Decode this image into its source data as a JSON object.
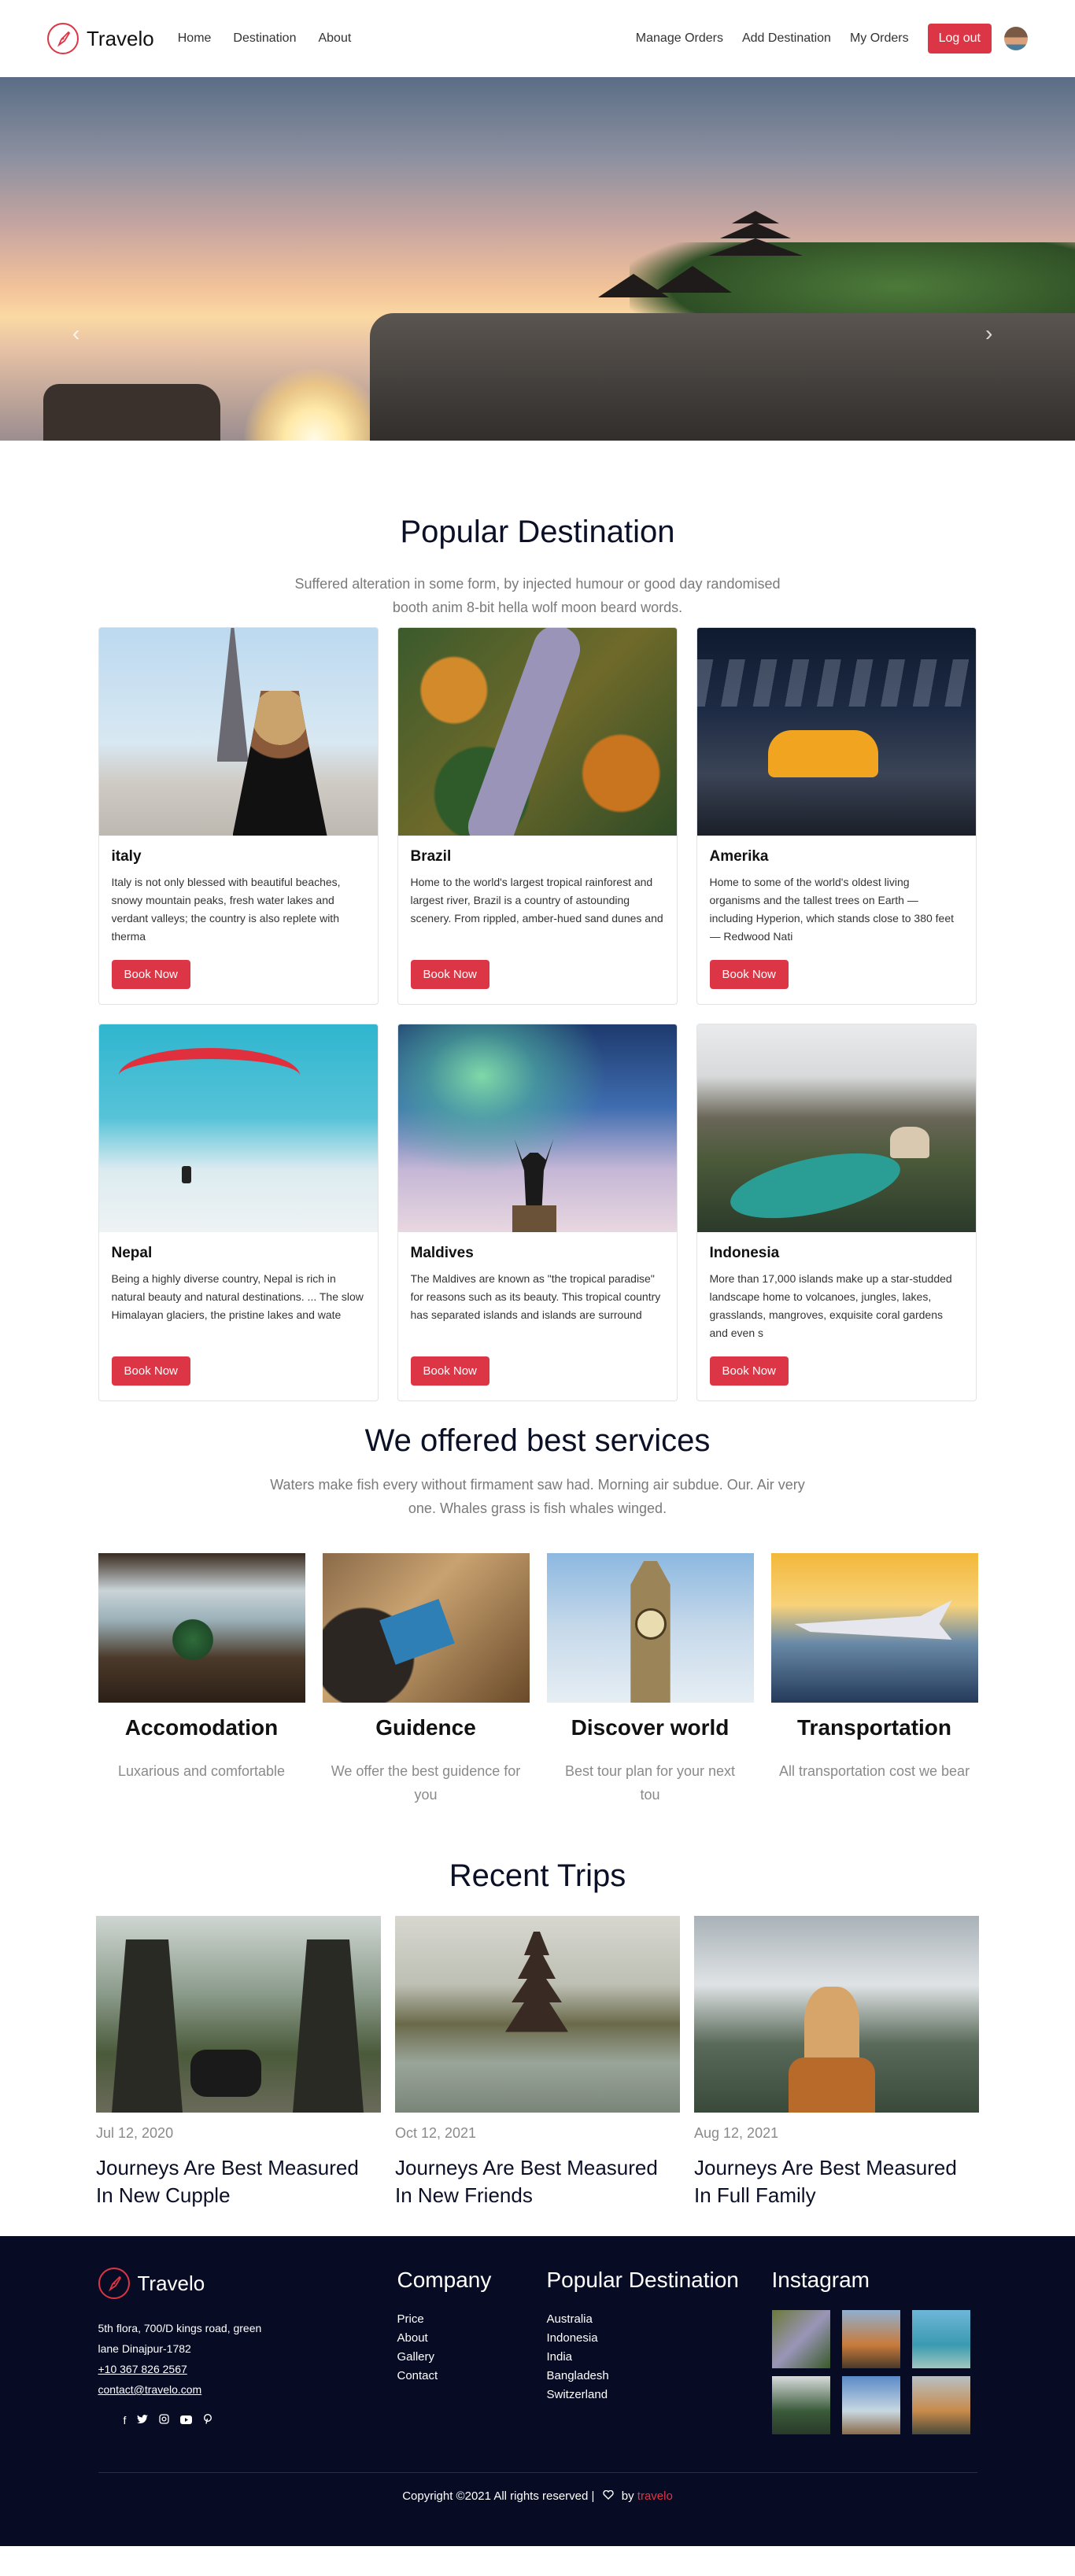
{
  "nav": {
    "brand": "Travelo",
    "links_left": [
      "Home",
      "Destination",
      "About"
    ],
    "links_right": [
      "Manage Orders",
      "Add Destination",
      "My Orders"
    ],
    "logout": "Log out"
  },
  "hero": {
    "prev": "‹",
    "next": "›"
  },
  "popular": {
    "title": "Popular Destination",
    "subtitle": "Suffered alteration in some form, by injected humour or good day randomised booth anim 8-bit hella wolf moon beard words.",
    "book_label": "Book Now",
    "cards": [
      {
        "name": "italy",
        "desc": "Italy is not only blessed with beautiful beaches, snowy mountain peaks, fresh water lakes and verdant valleys; the country is also replete with therma"
      },
      {
        "name": "Brazil",
        "desc": "Home to the world's largest tropical rainforest and largest river, Brazil is a country of astounding scenery. From rippled, amber-hued sand dunes and"
      },
      {
        "name": "Amerika",
        "desc": "Home to some of the world's oldest living organisms and the tallest trees on Earth — including Hyperion, which stands close to 380 feet — Redwood Nati"
      },
      {
        "name": "Nepal",
        "desc": "Being a highly diverse country, Nepal is rich in natural beauty and natural destinations. ... The slow Himalayan glaciers, the pristine lakes and wate"
      },
      {
        "name": "Maldives",
        "desc": "The Maldives are known as \"the tropical paradise\" for reasons such as its beauty. This tropical country has separated islands and islands are surround"
      },
      {
        "name": "Indonesia",
        "desc": "More than 17,000 islands make up a star-studded landscape home to volcanoes, jungles, lakes, grasslands, mangroves, exquisite coral gardens and even s"
      }
    ]
  },
  "services": {
    "title": "We offered best services",
    "subtitle": "Waters make fish every without firmament saw had. Morning air subdue. Our. Air very one. Whales grass is fish whales winged.",
    "items": [
      {
        "title": "Accomodation",
        "desc": "Luxarious and comfortable"
      },
      {
        "title": "Guidence",
        "desc": "We offer the best guidence for you"
      },
      {
        "title": "Discover world",
        "desc": "Best tour plan for your next tou"
      },
      {
        "title": "Transportation",
        "desc": "All transportation cost we bear"
      }
    ]
  },
  "trips": {
    "title": "Recent Trips",
    "items": [
      {
        "date": "Jul 12, 2020",
        "title": "Journeys Are Best Measured In New Cupple"
      },
      {
        "date": "Oct 12, 2021",
        "title": "Journeys Are Best Measured In New Friends"
      },
      {
        "date": "Aug 12, 2021",
        "title": "Journeys Are Best Measured In Full Family"
      }
    ]
  },
  "footer": {
    "brand": "Travelo",
    "address_line1": "5th flora, 700/D kings road, green",
    "address_line2": "lane Dinajpur-1782",
    "phone": "+10 367 826 2567",
    "email": "contact@travelo.com",
    "company_heading": "Company",
    "company_links": [
      "Price",
      "About",
      "Gallery",
      "Contact"
    ],
    "popular_heading": "Popular Destination",
    "popular_links": [
      "Australia",
      "Indonesia",
      "India",
      "Bangladesh",
      "Switzerland"
    ],
    "instagram_heading": "Instagram",
    "copyright": "Copyright ©2021 All rights reserved |",
    "by": "by",
    "by_brand": "travelo"
  },
  "colors": {
    "accent": "#dc3545",
    "footer_bg": "#070c24",
    "title": "#0b1027"
  }
}
